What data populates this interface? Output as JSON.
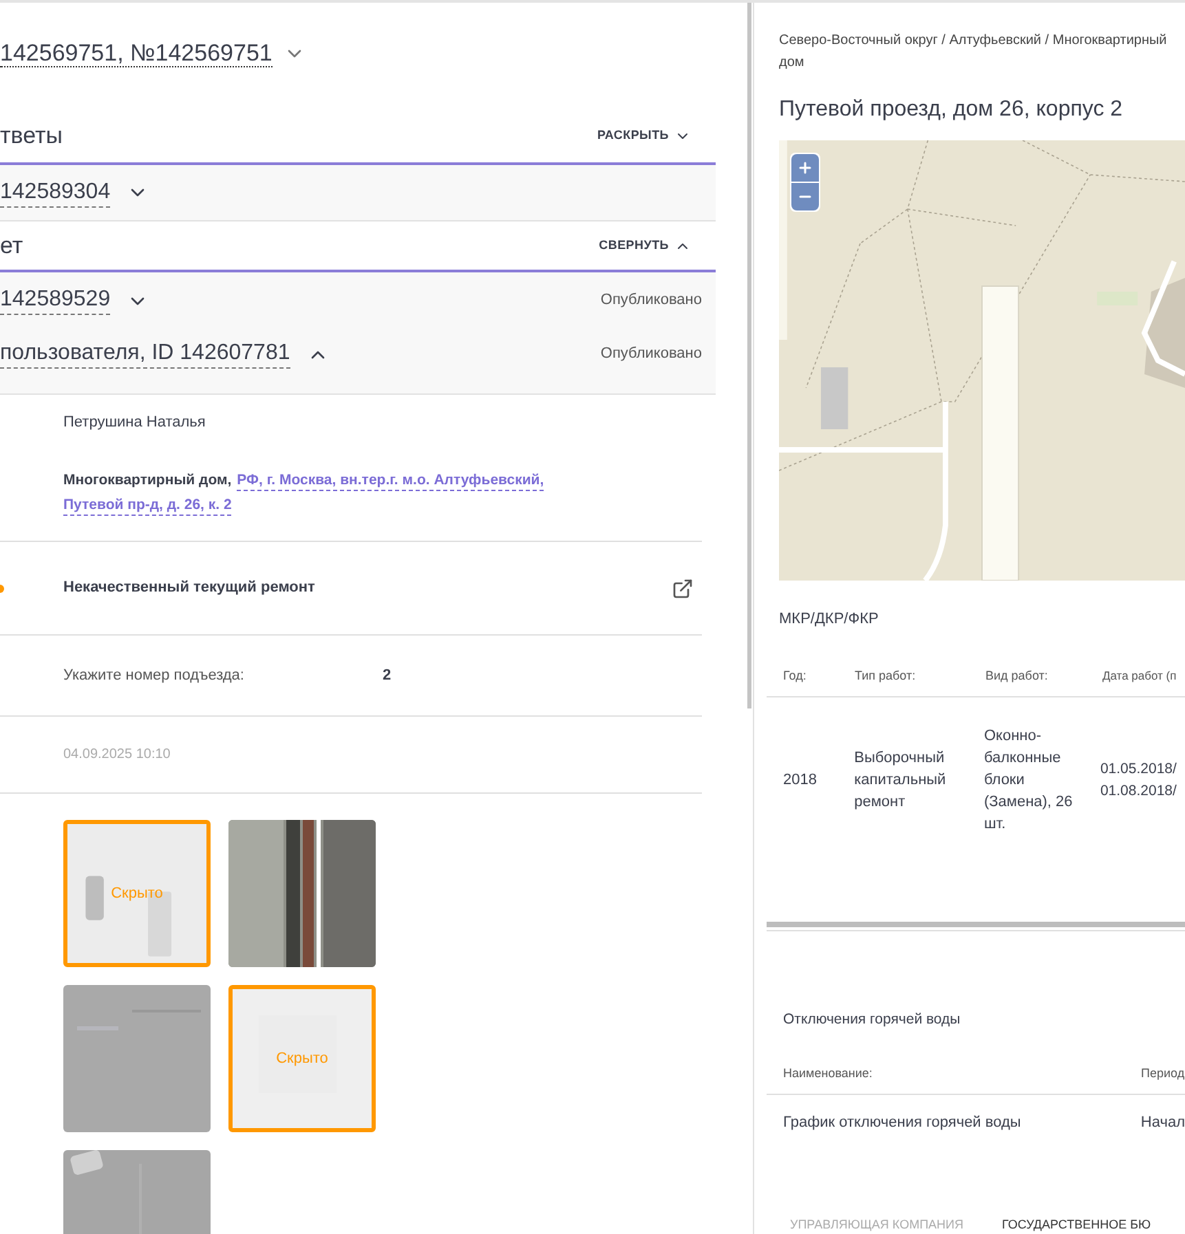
{
  "header": {
    "title": "142569751, №142569751",
    "expanded": false
  },
  "sections": [
    {
      "title": "тветы",
      "toggle": "РАСКРЫТЬ",
      "expanded": false,
      "items": [
        {
          "id": "142589304",
          "expanded": false
        }
      ]
    },
    {
      "title": "ет",
      "toggle": "СВЕРНУТЬ",
      "expanded": true,
      "items": [
        {
          "id": "142589529",
          "expanded": false,
          "status": "Опубликовано"
        },
        {
          "id": "пользователя, ID 142607781",
          "expanded": true,
          "status": "Опубликовано"
        }
      ]
    }
  ],
  "details": {
    "author": "Петрушина Наталья",
    "address_prefix": "Многоквартирный дом,",
    "address_link": [
      "РФ, г. Москва, вн.тер.г. м.о. Алтуфьевский,",
      "Путевой пр-д, д. 26, к. 2"
    ],
    "category": "Некачественный текущий ремонт",
    "question": "Укажите номер подъезда:",
    "answer": "2",
    "date": "04.09.2025 10:10",
    "photos": [
      {
        "hidden": true,
        "label": "Скрыто"
      },
      {
        "hidden": false
      },
      {
        "hidden": false
      },
      {
        "hidden": true,
        "label": "Скрыто"
      },
      {
        "hidden": false
      }
    ]
  },
  "object": {
    "breadcrumb": "Северо-Восточный округ / Алтуфьевский / Многоквартирный дом",
    "title": "Путевой проезд, дом 26, корпус 2"
  },
  "repairs": {
    "title": "МКР/ДКР/ФКР",
    "columns": [
      "Год:",
      "Тип работ:",
      "Вид работ:",
      "Дата работ (п"
    ],
    "rows": [
      [
        "2018",
        "Выборочный капитальный ремонт",
        "Оконно-балконные блоки (Замена), 26 шт.",
        "01.05.2018/ 01.08.2018/"
      ]
    ]
  },
  "hot_water": {
    "title": "Отключения горячей воды",
    "columns": [
      "Наименование:",
      "Период"
    ],
    "rows": [
      [
        "График отключения горячей воды",
        "Начал"
      ]
    ]
  },
  "bottom_tabs": [
    {
      "label": "УПРАВЛЯЮЩАЯ КОМПАНИЯ",
      "selected": false
    },
    {
      "label": "ГОСУДАРСТВЕННОЕ БЮ",
      "selected": true
    }
  ]
}
